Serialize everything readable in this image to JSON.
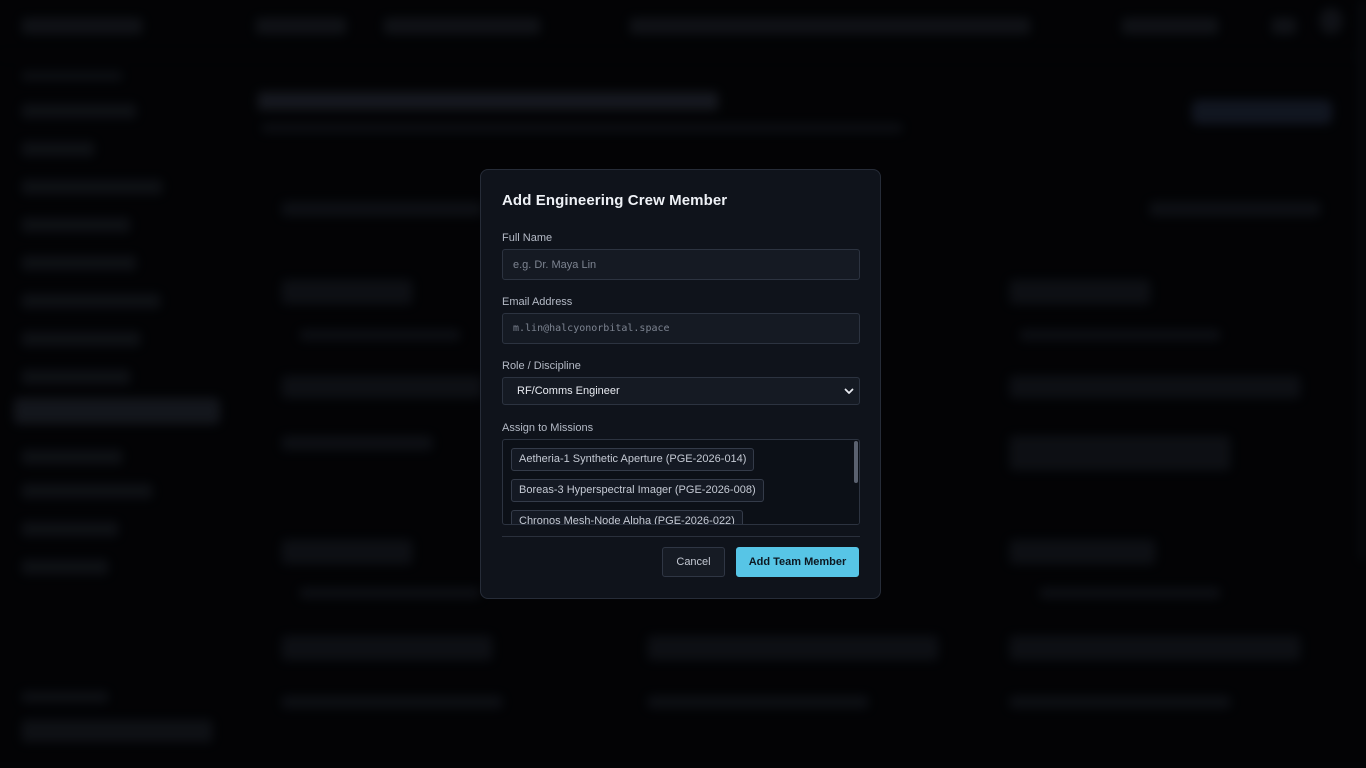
{
  "modal": {
    "title": "Add Engineering Crew Member",
    "full_name": {
      "label": "Full Name",
      "value": "",
      "placeholder": "e.g. Dr. Maya Lin"
    },
    "email": {
      "label": "Email Address",
      "value": "",
      "placeholder": "m.lin@halcyonorbital.space"
    },
    "role": {
      "label": "Role / Discipline",
      "selected": "RF/Comms Engineer"
    },
    "missions": {
      "label": "Assign to Missions",
      "items": [
        "Aetheria-1 Synthetic Aperture (PGE-2026-014)",
        "Boreas-3 Hyperspectral Imager (PGE-2026-008)",
        "Chronos Mesh-Node Alpha (PGE-2026-022)"
      ]
    },
    "cancel_label": "Cancel",
    "submit_label": "Add Team Member"
  },
  "colors": {
    "accent": "#57c5e6",
    "modal_bg": "#0f131b",
    "page_bg": "#050609"
  },
  "icons": {
    "select_chevron": "chevron-down-icon"
  }
}
